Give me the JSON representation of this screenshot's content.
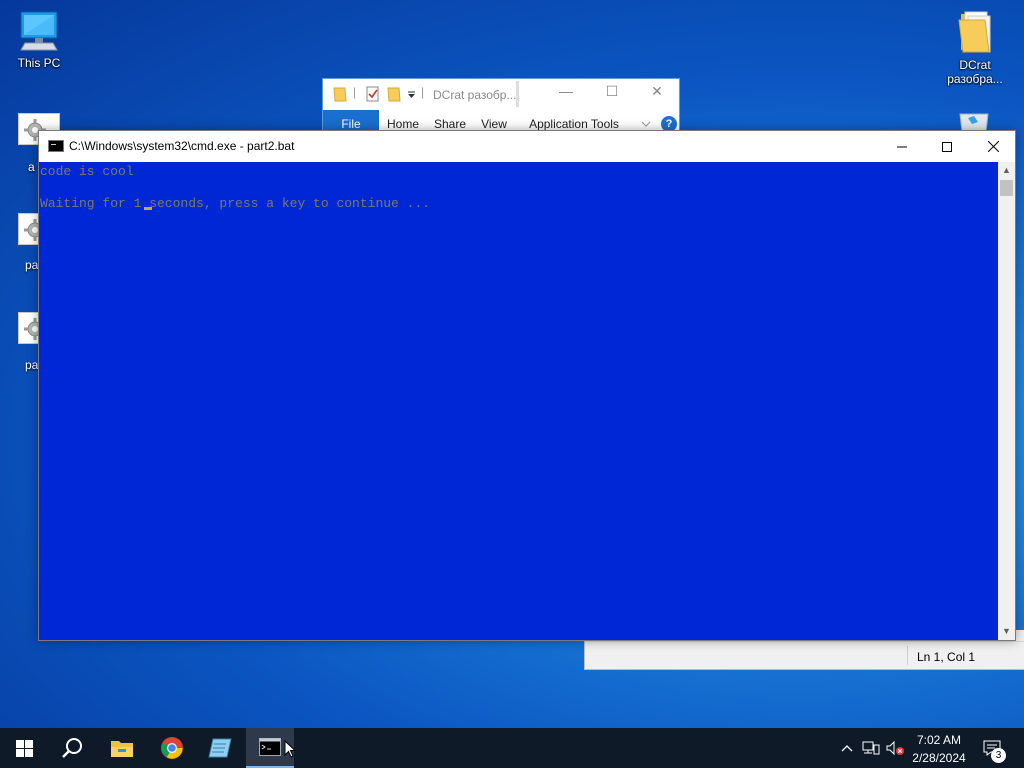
{
  "desktop": {
    "icons": [
      {
        "label": "This PC"
      },
      {
        "label": "DCrat разобра..."
      }
    ],
    "partial_labels": [
      "a",
      "pa",
      "pa"
    ]
  },
  "explorer": {
    "title": "DCrat разобр...",
    "tabs": [
      "File",
      "Home",
      "Share",
      "View",
      "Application Tools"
    ],
    "help": "?"
  },
  "notepad": {
    "status_position": "Ln 1, Col 1"
  },
  "cmd": {
    "title": "C:\\Windows\\system32\\cmd.exe - part2.bat",
    "lines": [
      "code is cool",
      "Waiting for 1 seconds, press a key to continue ..."
    ],
    "background_color": "#0027d6"
  },
  "taskbar": {
    "time": "7:02 AM",
    "date": "2/28/2024",
    "notification_count": "3"
  }
}
